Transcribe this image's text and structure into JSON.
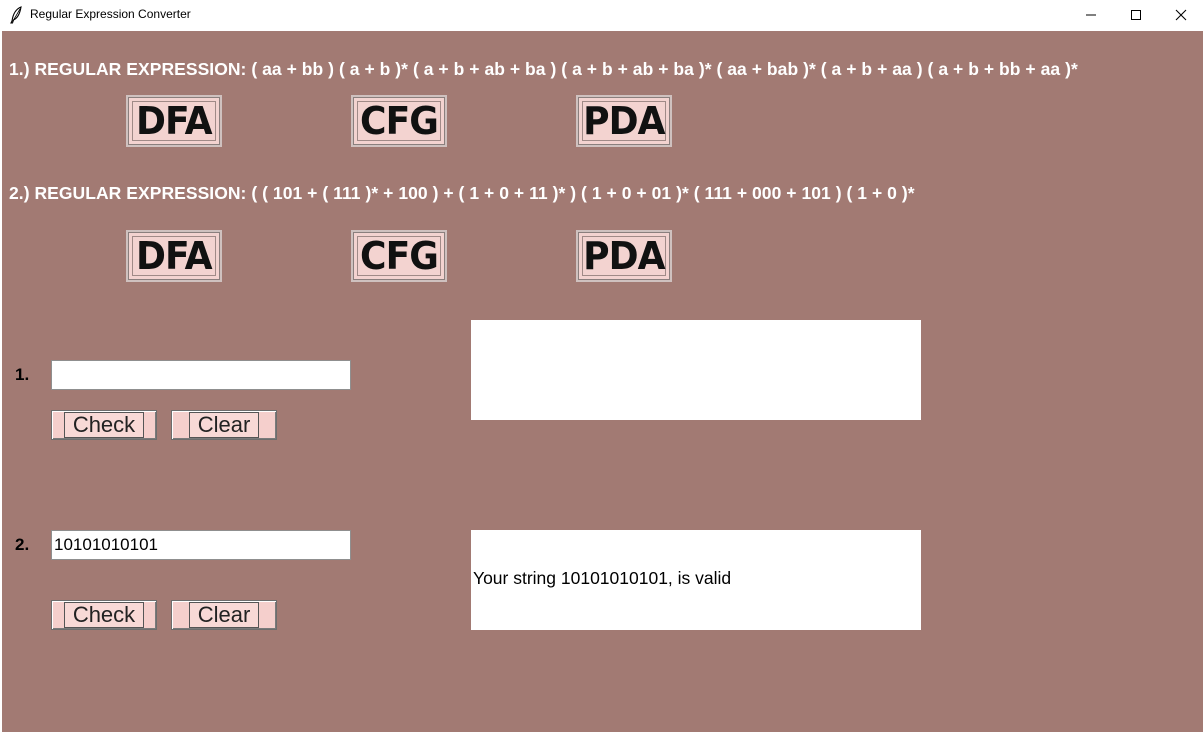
{
  "window": {
    "title": "Regular Expression Converter",
    "controls": [
      "minimize",
      "maximize",
      "close"
    ]
  },
  "regex1": {
    "label": "1.) REGULAR EXPRESSION: ( aa + bb ) ( a + b )* ( a + b + ab + ba ) ( a + b + ab + ba )* ( aa + bab )* ( a + b + aa ) ( a + b + bb + aa )*",
    "buttons": {
      "dfa": "DFA",
      "cfg": "CFG",
      "pda": "PDA"
    }
  },
  "regex2": {
    "label": "2.) REGULAR EXPRESSION: ( ( 101 + ( 111 )* + 100 ) + ( 1 + 0 + 11 )* ) ( 1 + 0 + 01 )* ( 111 + 000 + 101 ) ( 1 + 0 )*",
    "buttons": {
      "dfa": "DFA",
      "cfg": "CFG",
      "pda": "PDA"
    }
  },
  "checker1": {
    "number": "1.",
    "input_value": "",
    "check_label": "Check",
    "clear_label": "Clear",
    "result": ""
  },
  "checker2": {
    "number": "2.",
    "input_value": "10101010101",
    "check_label": "Check",
    "clear_label": "Clear",
    "result": "Your string 10101010101, is valid"
  },
  "colors": {
    "background": "#a27a73",
    "button_face": "#f5cfcc",
    "text_white": "#ffffff"
  }
}
